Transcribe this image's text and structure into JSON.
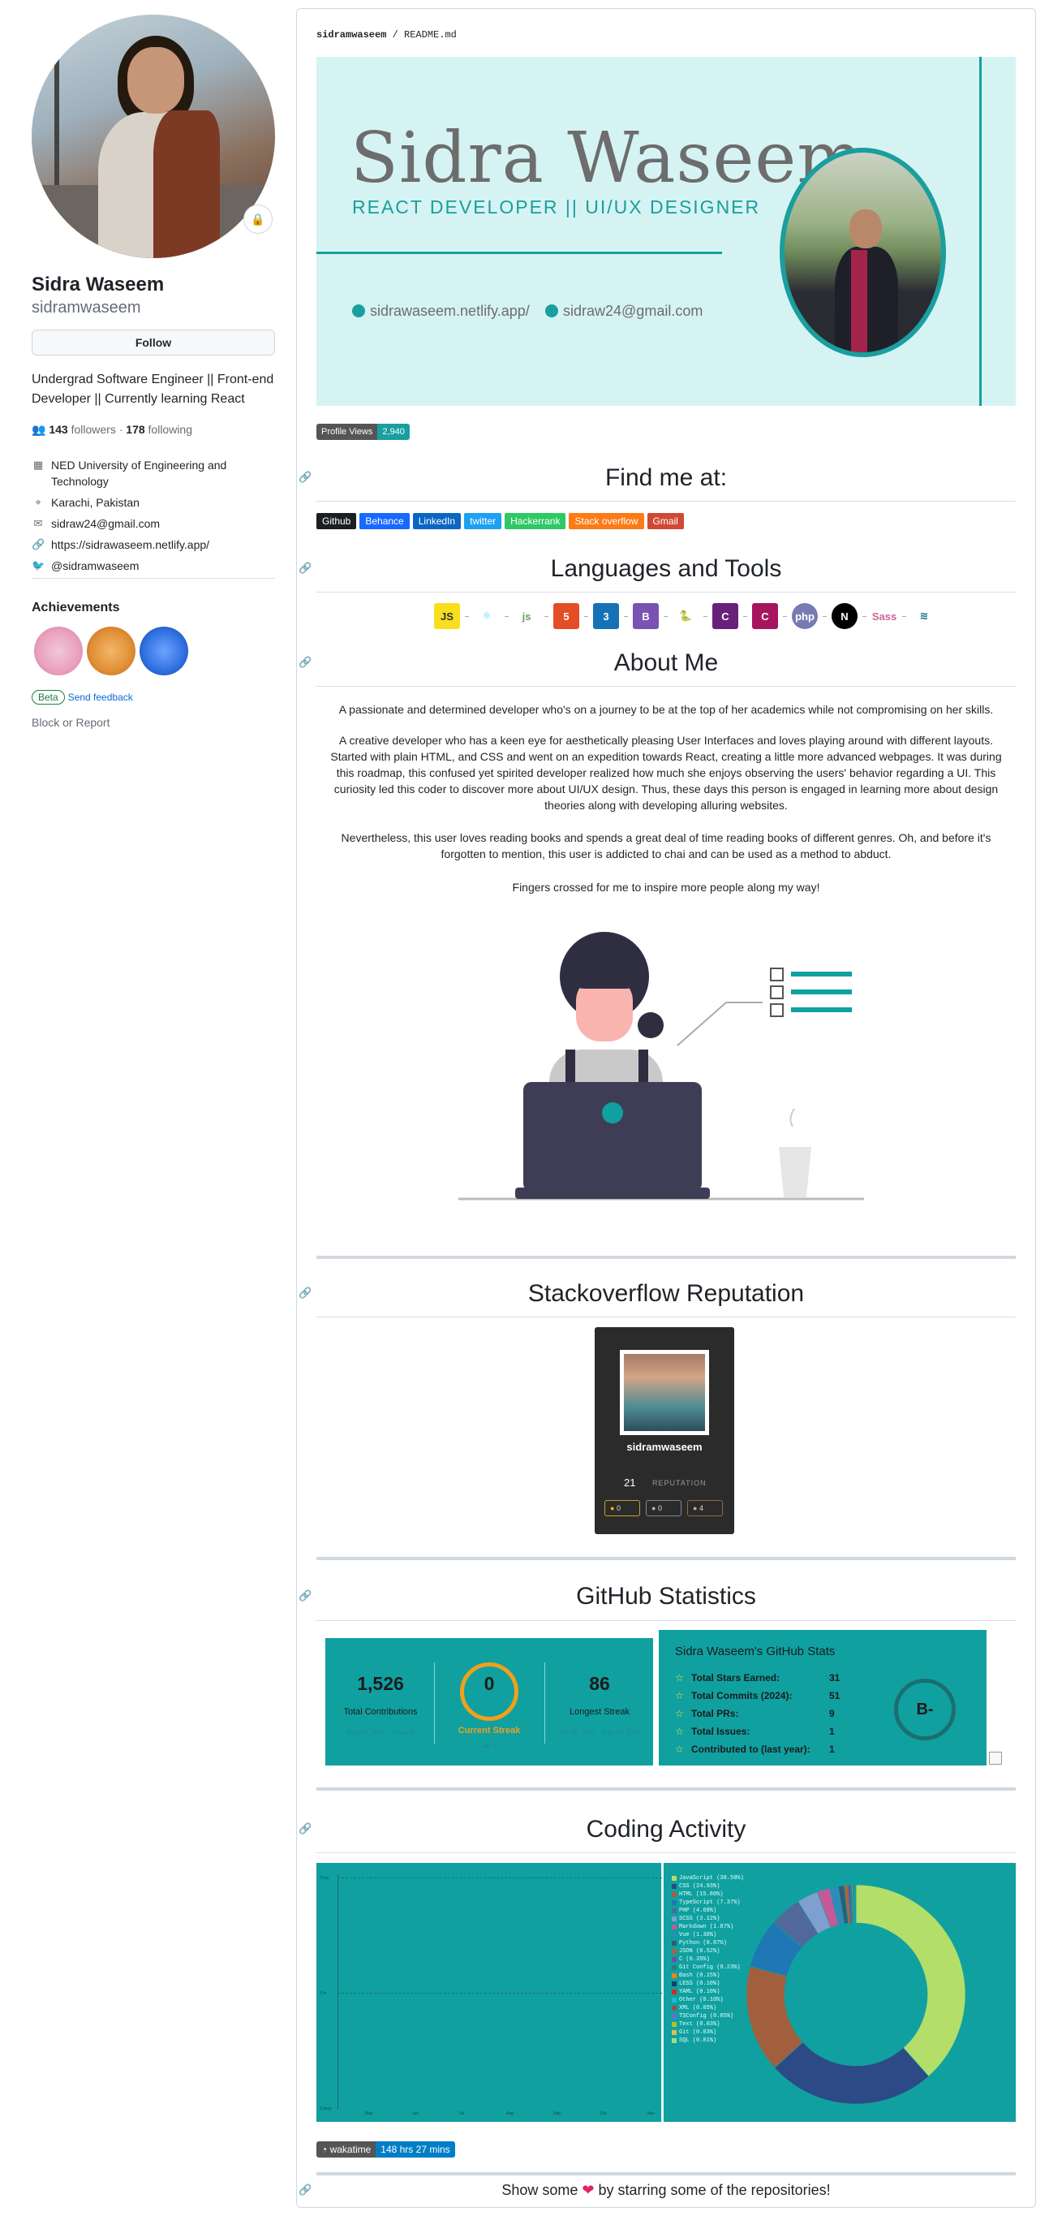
{
  "profile": {
    "name": "Sidra Waseem",
    "login": "sidramwaseem",
    "follow_label": "Follow",
    "bio": "Undergrad Software Engineer || Front-end Developer || Currently learning React",
    "followers_count": "143",
    "followers_label": "followers",
    "following_count": "178",
    "following_label": "following",
    "organization": "NED University of Engineering and Technology",
    "location": "Karachi, Pakistan",
    "email": "sidraw24@gmail.com",
    "website": "https://sidrawaseem.netlify.app/",
    "twitter": "@sidramwaseem",
    "achievements_title": "Achievements",
    "beta_label": "Beta",
    "feedback_label": "Send feedback",
    "block_label": "Block or Report"
  },
  "readme": {
    "breadcrumb_user": "sidramwaseem",
    "breadcrumb_sep": " / ",
    "breadcrumb_file": "README.md",
    "banner": {
      "title": "Sidra Waseem",
      "subtitle": "REACT DEVELOPER || UI/UX DESIGNER",
      "site": "sidrawaseem.netlify.app/",
      "email": "sidraw24@gmail.com"
    },
    "views": {
      "label": "Profile Views",
      "value": "2,940"
    },
    "find_me_heading": "Find me at:",
    "social_badges": [
      {
        "label": "Github",
        "color": "#1b1f23"
      },
      {
        "label": "Behance",
        "color": "#1769ff"
      },
      {
        "label": "LinkedIn",
        "color": "#0a66c2"
      },
      {
        "label": "twitter",
        "color": "#1da1f2"
      },
      {
        "label": "Hackerrank",
        "color": "#2ec866"
      },
      {
        "label": "Stack overflow",
        "color": "#fe7a16"
      },
      {
        "label": "Gmail",
        "color": "#d14836"
      }
    ],
    "languages_heading": "Languages and Tools",
    "tools": [
      {
        "icon": "javascript-icon",
        "glyph": "JS",
        "bg": "#f7df1e",
        "fg": "#333"
      },
      {
        "icon": "react-icon",
        "glyph": "⚛",
        "bg": "transparent",
        "fg": "#61dafb"
      },
      {
        "icon": "nodejs-icon",
        "glyph": "js",
        "bg": "transparent",
        "fg": "#68a063"
      },
      {
        "icon": "html5-icon",
        "glyph": "5",
        "bg": "#e44d26",
        "fg": "#fff"
      },
      {
        "icon": "css3-icon",
        "glyph": "3",
        "bg": "#1572b6",
        "fg": "#fff"
      },
      {
        "icon": "bootstrap-icon",
        "glyph": "B",
        "bg": "#7952b3",
        "fg": "#fff"
      },
      {
        "icon": "python-icon",
        "glyph": "🐍",
        "bg": "transparent",
        "fg": "#3776ab"
      },
      {
        "icon": "csharp-icon",
        "glyph": "C",
        "bg": "#68217a",
        "fg": "#fff"
      },
      {
        "icon": "cplusplus-icon",
        "glyph": "C",
        "bg": "#a8155f",
        "fg": "#fff"
      },
      {
        "icon": "php-icon",
        "glyph": "php",
        "bg": "#777bb3",
        "fg": "#fff"
      },
      {
        "icon": "nextjs-icon",
        "glyph": "N",
        "bg": "#000",
        "fg": "#fff"
      },
      {
        "icon": "sass-icon",
        "glyph": "Sass",
        "bg": "transparent",
        "fg": "#cc6699"
      },
      {
        "icon": "tailwind-icon",
        "glyph": "≋",
        "bg": "transparent",
        "fg": "#0e6b8a"
      }
    ],
    "about_heading": "About Me",
    "about_p1": "A passionate and determined developer who's on a journey to be at the top of her academics while not compromising on her skills.",
    "about_p2": "A creative developer who has a keen eye for aesthetically pleasing User Interfaces and loves playing around with different layouts. Started with plain HTML, and CSS and went on an expedition towards React, creating a little more advanced webpages. It was during this roadmap, this confused yet spirited developer realized how much she enjoys observing the users' behavior regarding a UI. This curiosity led this coder to discover more about UI/UX design. Thus, these days this person is engaged in learning more about design theories along with developing alluring websites.",
    "about_p3": "Nevertheless, this user loves reading books and spends a great deal of time reading books of different genres. Oh, and before it's forgotten to mention, this user is addicted to chai and can be used as a method to abduct.",
    "about_p4": "Fingers crossed for me to inspire more people along my way!",
    "so_heading": "Stackoverflow Reputation",
    "so_card": {
      "name": "sidramwaseem",
      "reputation": "21",
      "reputation_label": "REPUTATION",
      "gold": "0",
      "silver": "0",
      "bronze": "4"
    },
    "gh_heading": "GitHub Statistics",
    "streak": {
      "total": "1,526",
      "total_label": "Total Contributions",
      "total_range": "Sep 25, 2020 - Present",
      "current": "0",
      "current_label": "Current Streak",
      "current_date": "Jan 4",
      "longest": "86",
      "longest_label": "Longest Streak",
      "longest_range": "Jun 30, 2022 - Sep 23, 2022"
    },
    "stats": {
      "title": "Sidra Waseem's GitHub Stats",
      "rows": [
        {
          "icon": "star-icon",
          "label": "Total Stars Earned:",
          "value": "31"
        },
        {
          "icon": "history-icon",
          "label": "Total Commits (2024):",
          "value": "51"
        },
        {
          "icon": "pr-icon",
          "label": "Total PRs:",
          "value": "9"
        },
        {
          "icon": "issue-icon",
          "label": "Total Issues:",
          "value": "1"
        },
        {
          "icon": "repo-icon",
          "label": "Contributed to (last year):",
          "value": "1"
        }
      ],
      "grade": "B-"
    },
    "coding_heading": "Coding Activity",
    "wakatime": {
      "label": "wakatime",
      "value": "148 hrs 27 mins"
    },
    "footer_left": "Show some",
    "footer_right": "by starring some of the repositories!"
  },
  "chart_data": {
    "type": "pie",
    "title": "",
    "categories": [
      "JavaScript",
      "CSS",
      "HTML",
      "TypeScript",
      "PHP",
      "SCSS",
      "Markdown",
      "Vue",
      "Python",
      "JSON",
      "C",
      "Git Config",
      "Bash",
      "LESS",
      "YAML",
      "Other",
      "XML",
      "TSConfig",
      "Text",
      "Git",
      "SQL"
    ],
    "values": [
      38.5,
      24.93,
      15.8,
      7.37,
      4.68,
      3.12,
      1.87,
      1.3,
      0.87,
      0.52,
      0.35,
      0.23,
      0.15,
      0.1,
      0.1,
      0.1,
      0.05,
      0.05,
      0.03,
      0.03,
      0.01
    ],
    "colors": [
      "#b3de69",
      "#2c4a86",
      "#a15f3d",
      "#1f77b4",
      "#50689a",
      "#7f9fcf",
      "#c35a98",
      "#2f8bbb",
      "#2a6077",
      "#b45f3d",
      "#7b4a9c",
      "#2b7a86",
      "#ff7f0e",
      "#1f3d6b",
      "#d62728",
      "#17becf",
      "#8c564b",
      "#6b6ecf",
      "#bcbd22",
      "#e7ba52",
      "#98df8a"
    ],
    "legend_labels": [
      "JavaScript (38.50%)",
      "CSS (24.93%)",
      "HTML (15.80%)",
      "TypeScript (7.37%)",
      "PHP (4.68%)",
      "SCSS (3.12%)",
      "Markdown (1.87%)",
      "Vue (1.30%)",
      "Python (0.87%)",
      "JSON (0.52%)",
      "C (0.35%)",
      "Git Config (0.23%)",
      "Bash (0.15%)",
      "LESS (0.10%)",
      "YAML (0.10%)",
      "Other (0.10%)",
      "XML (0.05%)",
      "TSConfig (0.05%)",
      "Text (0.03%)",
      "Git (0.03%)",
      "SQL (0.01%)"
    ],
    "line_yticks": [
      "2 hrs",
      "1 hr",
      "0 secs"
    ],
    "line_xticks": [
      "May",
      "Jun",
      "Jul",
      "Aug",
      "Sep",
      "Oct",
      "Nov"
    ],
    "legend_position": "left"
  }
}
